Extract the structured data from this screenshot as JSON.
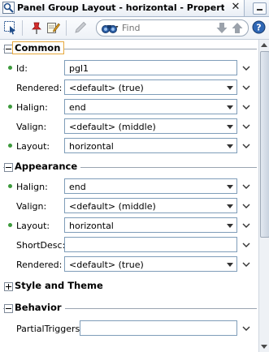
{
  "window": {
    "tab_title": "Panel Group Layout - horizontal - Property I...",
    "tab_icon": "property-inspector-icon",
    "close_glyph": "✕"
  },
  "toolbar": {
    "search_placeholder": "Find",
    "icons": [
      "select-component-icon",
      "pin-icon",
      "edit-icon",
      "pencil-icon",
      "binoculars-icon",
      "down-arrow-icon",
      "up-arrow-icon",
      "help-icon"
    ]
  },
  "sections": {
    "common": {
      "title": "Common",
      "expanded": true,
      "rows": {
        "id": {
          "label": "Id:",
          "value": "pgl1",
          "required": true
        },
        "rendered": {
          "label": "Rendered:",
          "value": "<default> (true)",
          "required": false
        },
        "halign": {
          "label": "Halign:",
          "value": "end",
          "required": true
        },
        "valign": {
          "label": "Valign:",
          "value": "<default> (middle)",
          "required": false
        },
        "layout": {
          "label": "Layout:",
          "value": "horizontal",
          "required": true
        }
      }
    },
    "appearance": {
      "title": "Appearance",
      "expanded": true,
      "rows": {
        "halign": {
          "label": "Halign:",
          "value": "end",
          "required": true
        },
        "valign": {
          "label": "Valign:",
          "value": "<default> (middle)",
          "required": false
        },
        "layout": {
          "label": "Layout:",
          "value": "horizontal",
          "required": true
        },
        "shortdesc": {
          "label": "ShortDesc:",
          "value": "",
          "required": false
        },
        "rendered": {
          "label": "Rendered:",
          "value": "<default> (true)",
          "required": false
        }
      }
    },
    "style_theme": {
      "title": "Style and Theme",
      "expanded": false
    },
    "behavior": {
      "title": "Behavior",
      "expanded": true,
      "rows": {
        "partialtriggers": {
          "label": "PartialTriggers:",
          "value": "",
          "required": false
        }
      }
    }
  },
  "colors": {
    "required_marker": "#3c9a3c",
    "focus_outline": "#e7a83c",
    "field_border": "#7f9db9"
  }
}
